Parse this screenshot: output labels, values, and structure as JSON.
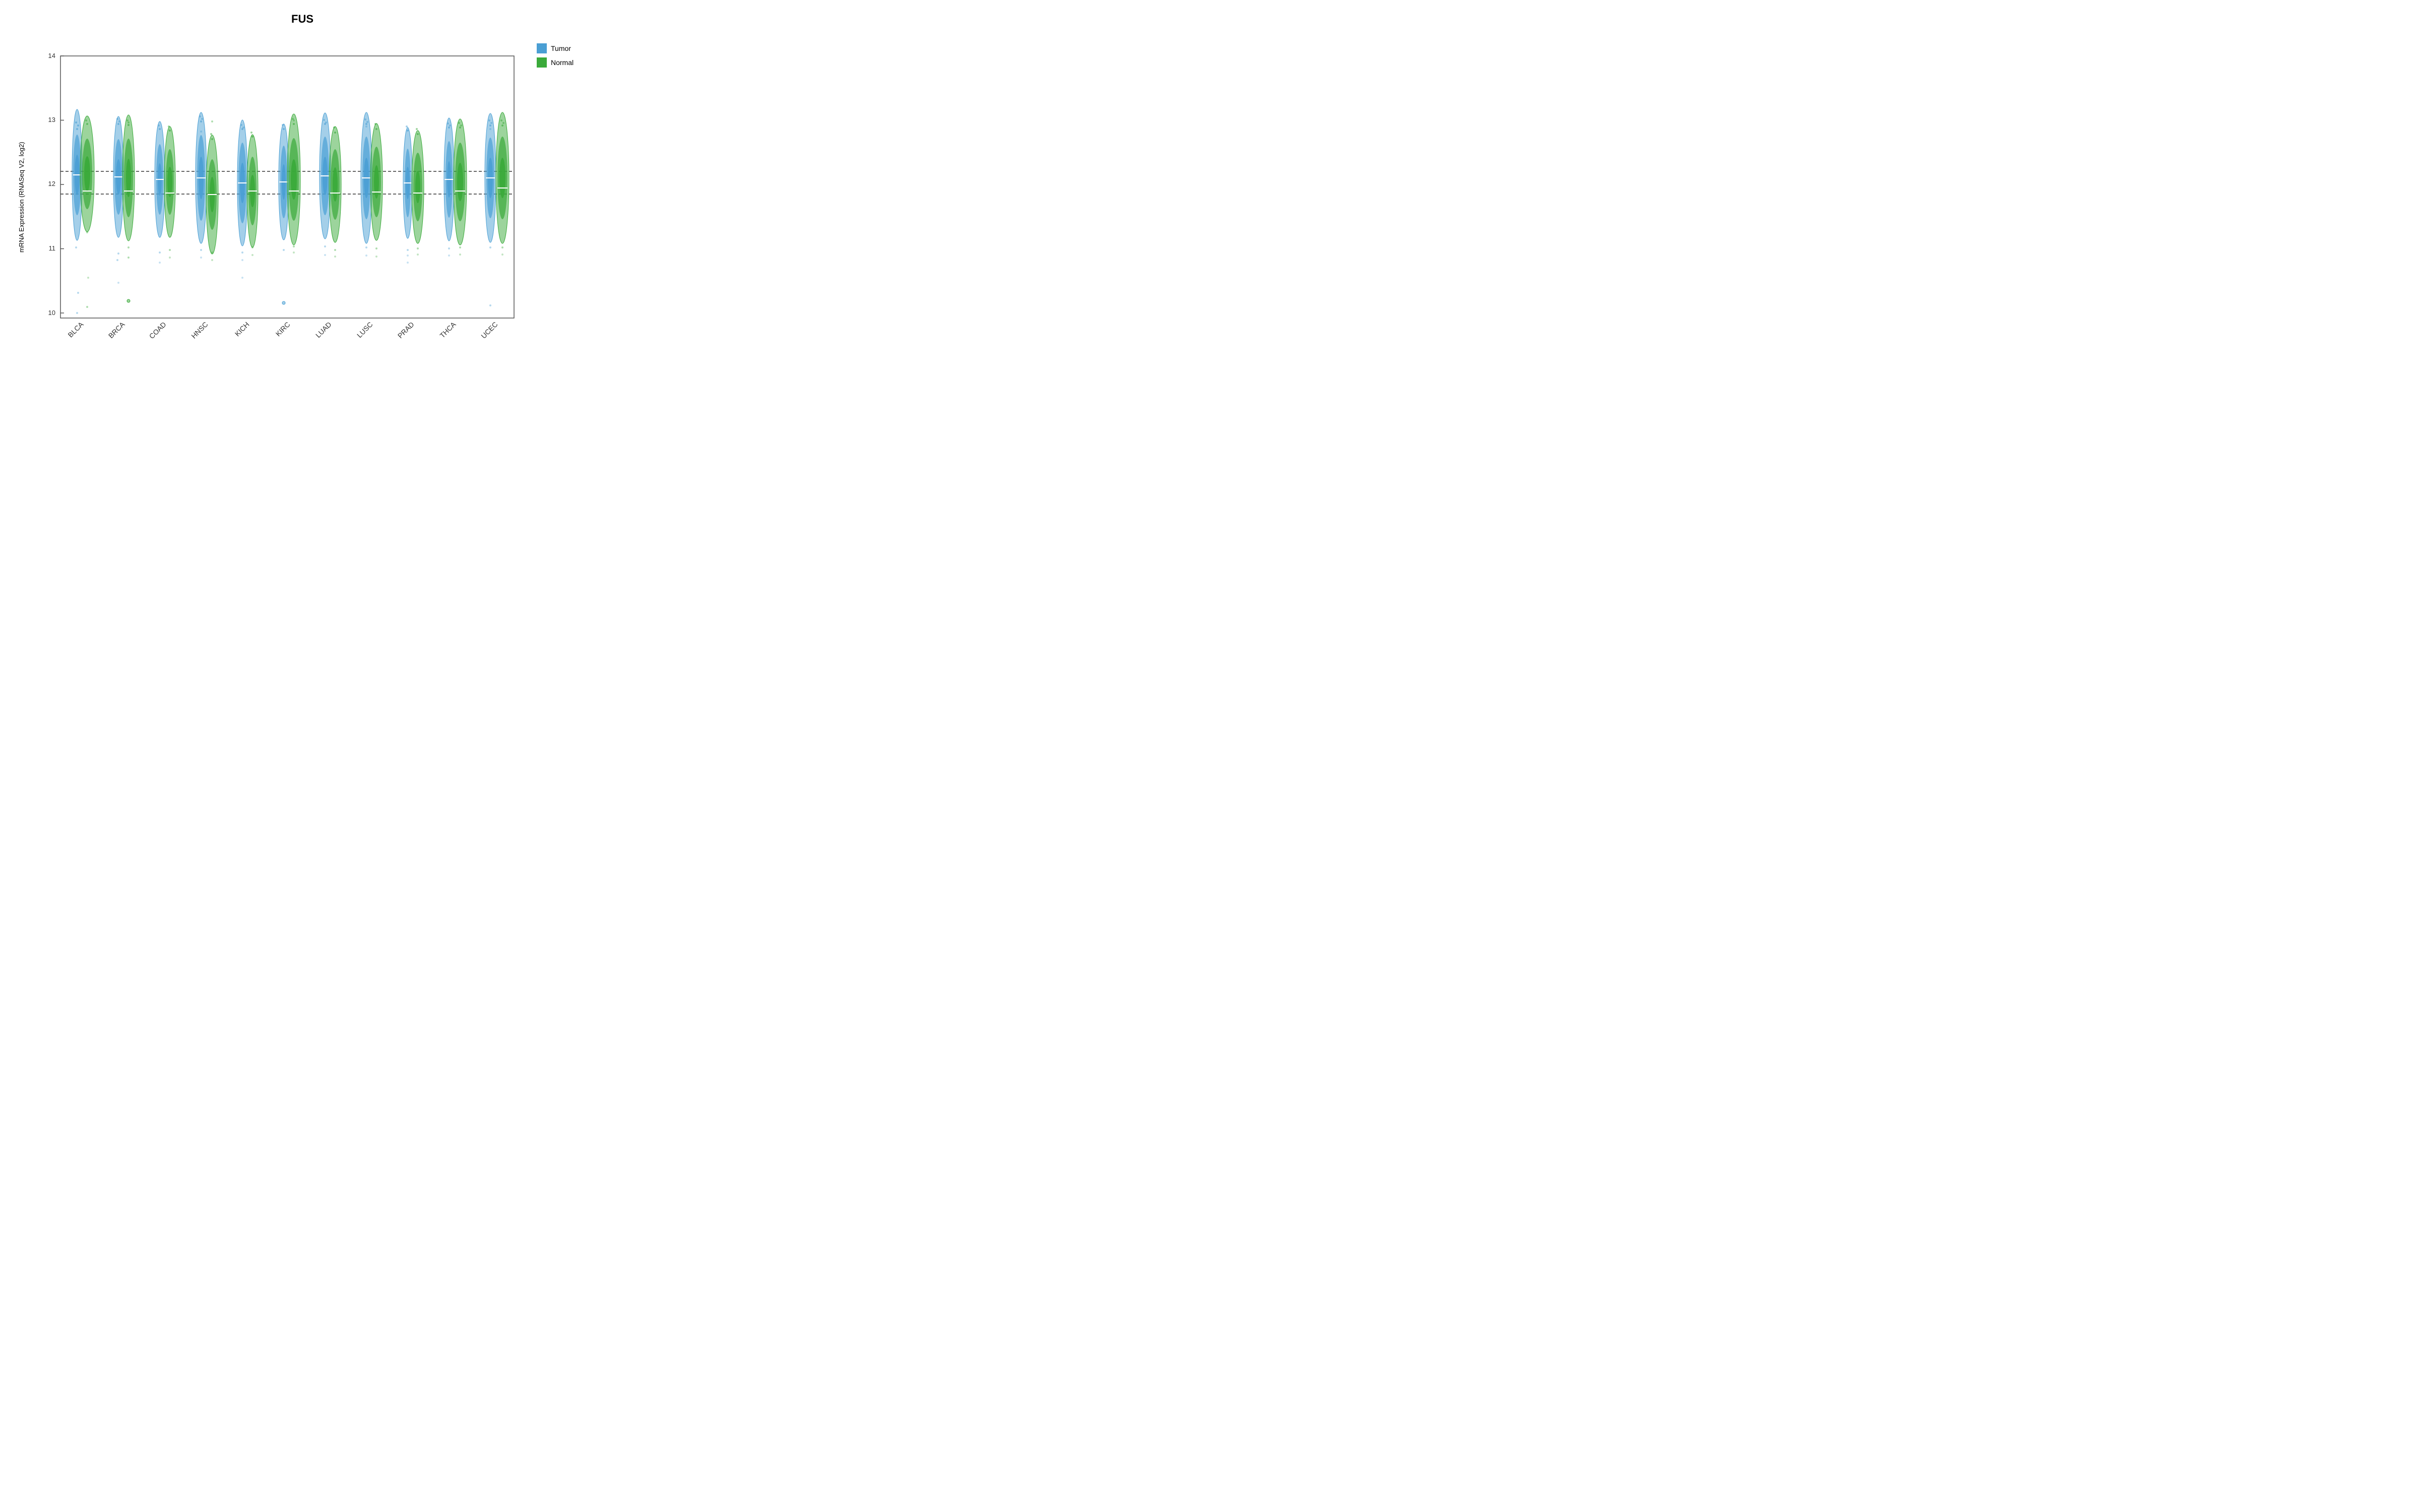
{
  "title": "FUS",
  "yAxisLabel": "mRNA Expression (RNASeq V2, log2)",
  "xLabels": [
    "BLCA",
    "BRCA",
    "COAD",
    "HNSC",
    "KICH",
    "KIRC",
    "LUAD",
    "LUSC",
    "PRAD",
    "THCA",
    "UCEC"
  ],
  "legend": {
    "items": [
      {
        "label": "Tumor",
        "color": "#3a8fc4"
      },
      {
        "label": "Normal",
        "color": "#3a9a3a"
      }
    ]
  },
  "yAxis": {
    "min": 10,
    "max": 14,
    "ticks": [
      10,
      11,
      12,
      13,
      14
    ]
  },
  "dottedLines": [
    12.2,
    11.85
  ],
  "colors": {
    "tumor": "#4a9fd4",
    "normal": "#3aaa3a",
    "border": "#333",
    "dotted": "#333"
  }
}
